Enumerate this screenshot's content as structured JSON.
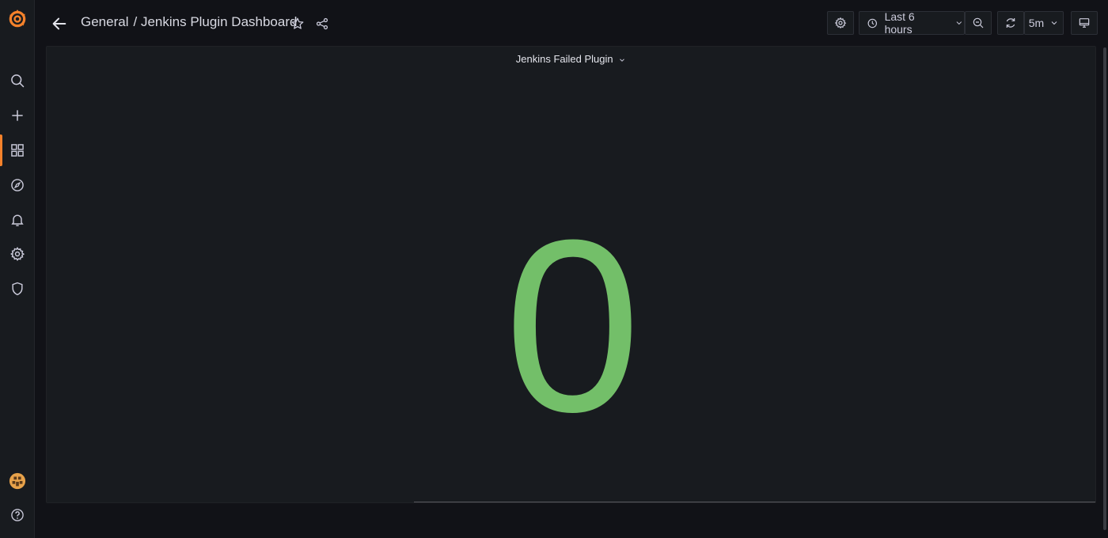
{
  "nav": {
    "items": [
      {
        "name": "search-icon",
        "active": false
      },
      {
        "name": "plus-icon",
        "active": false
      },
      {
        "name": "dashboards-icon",
        "active": true
      },
      {
        "name": "explore-icon",
        "active": false
      },
      {
        "name": "alerting-bell-icon",
        "active": false
      },
      {
        "name": "configuration-gear-icon",
        "active": false
      },
      {
        "name": "server-admin-shield-icon",
        "active": false
      }
    ],
    "bottom": [
      "user-avatar",
      "help-icon"
    ]
  },
  "header": {
    "breadcrumb_folder": "General",
    "breadcrumb_separator": "/",
    "breadcrumb_dashboard": "Jenkins Plugin Dashboard"
  },
  "toolbar": {
    "time_range_label": "Last 6 hours",
    "refresh_interval": "5m"
  },
  "panel": {
    "title": "Jenkins Failed Plugin",
    "value": "0"
  },
  "colors": {
    "accent": "#f5822b",
    "stat_green": "#73bf69",
    "background": "#111217",
    "panel_bg": "#181b1f"
  }
}
